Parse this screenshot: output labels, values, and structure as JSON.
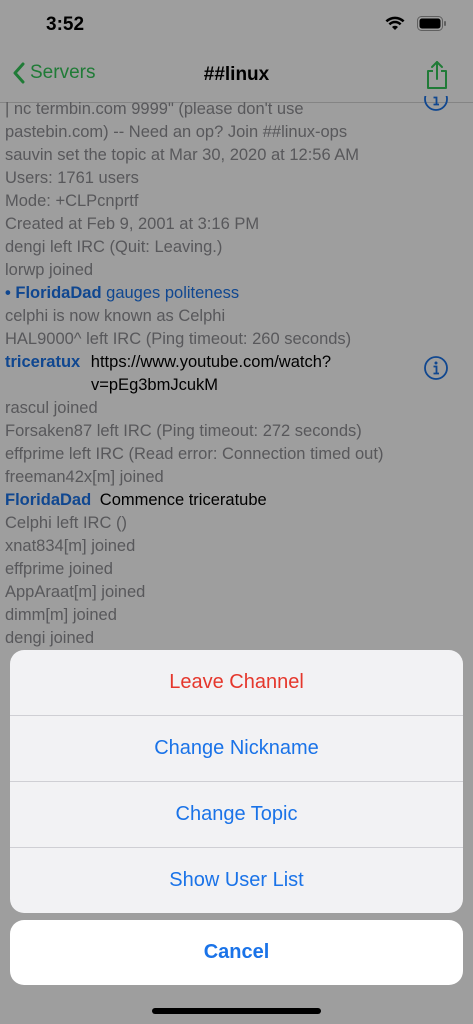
{
  "status": {
    "time": "3:52"
  },
  "nav": {
    "back_label": "Servers",
    "title": "##linux"
  },
  "log": [
    {
      "kind": "plain",
      "text": "| nc termbin.com 9999\" (please don't use"
    },
    {
      "kind": "plain",
      "text": "pastebin.com) -- Need an op? Join ##linux-ops"
    },
    {
      "kind": "plain",
      "text": "sauvin set the topic at Mar 30, 2020 at 12:56 AM"
    },
    {
      "kind": "plain",
      "text": "Users: 1761 users"
    },
    {
      "kind": "plain",
      "text": "Mode: +CLPcnprtf"
    },
    {
      "kind": "plain",
      "text": "Created at Feb 9, 2001 at 3:16 PM"
    },
    {
      "kind": "plain",
      "text": "dengi left IRC (Quit: Leaving.)"
    },
    {
      "kind": "plain",
      "text": "lorwp joined"
    },
    {
      "kind": "action",
      "nick": "• FloridaDad",
      "text": "gauges politeness"
    },
    {
      "kind": "plain",
      "text": "celphi is now known as Celphi"
    },
    {
      "kind": "plain",
      "text": "HAL9000^ left IRC (Ping timeout: 260 seconds)"
    },
    {
      "kind": "message",
      "nick": "triceratux",
      "text": "https://www.youtube.com/watch?",
      "text2": "v=pEg3bmJcukM"
    },
    {
      "kind": "plain",
      "text": "rascul joined"
    },
    {
      "kind": "plain",
      "text": "Forsaken87 left IRC (Ping timeout: 272 seconds)"
    },
    {
      "kind": "plain",
      "text": "effprime left IRC (Read error: Connection timed out)"
    },
    {
      "kind": "plain",
      "text": "freeman42x[m] joined"
    },
    {
      "kind": "message",
      "nick": "FloridaDad",
      "text": "Commence triceratube"
    },
    {
      "kind": "plain",
      "text": "Celphi left IRC ()"
    },
    {
      "kind": "plain",
      "text": "xnat834[m] joined"
    },
    {
      "kind": "plain",
      "text": "effprime joined"
    },
    {
      "kind": "plain",
      "text": "AppAraat[m] joined"
    },
    {
      "kind": "plain",
      "text": "dimm[m] joined"
    },
    {
      "kind": "plain",
      "text": "dengi joined"
    }
  ],
  "sheet": {
    "leave": "Leave Channel",
    "change_nick": "Change Nickname",
    "change_topic": "Change Topic",
    "show_users": "Show User List",
    "cancel": "Cancel"
  },
  "colors": {
    "accent": "#1a73e8",
    "destructive": "#e5372c",
    "back": "#34c759"
  }
}
